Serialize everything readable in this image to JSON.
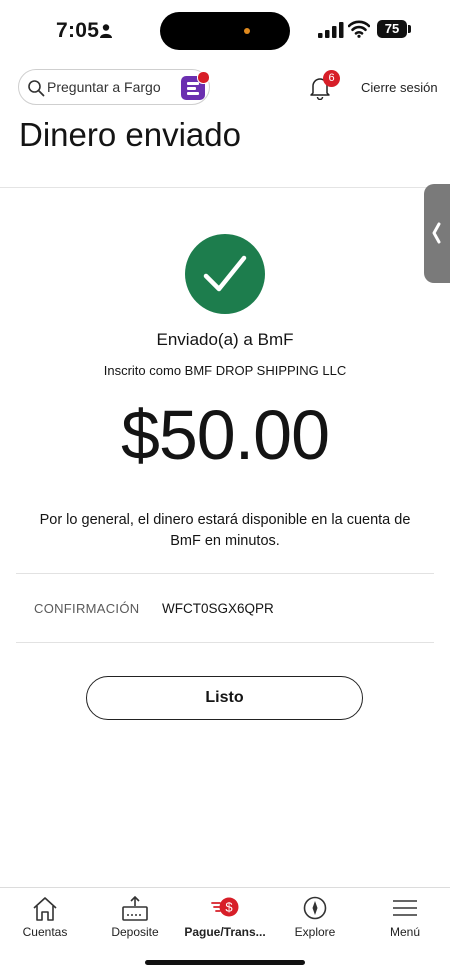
{
  "status_bar": {
    "time": "7:05",
    "battery": "75"
  },
  "header": {
    "search_label": "Preguntar a Fargo",
    "notification_count": "6",
    "sign_out": "Cierre sesión"
  },
  "page": {
    "title": "Dinero enviado"
  },
  "confirmation": {
    "sent_to": "Enviado(a) a BmF",
    "registered_as": "Inscrito como BMF DROP SHIPPING LLC",
    "amount": "$50.00",
    "availability_note": "Por lo general, el dinero estará disponible en la cuenta de BmF en minutos.",
    "confirmation_label": "CONFIRMACIÓN",
    "confirmation_number": "WFCT0SGX6QPR",
    "done_label": "Listo"
  },
  "tabs": [
    {
      "label": "Cuentas",
      "icon": "home-icon"
    },
    {
      "label": "Deposite",
      "icon": "deposit-icon"
    },
    {
      "label": "Pague/Trans...",
      "icon": "pay-transfer-icon",
      "active": true
    },
    {
      "label": "Explore",
      "icon": "compass-icon"
    },
    {
      "label": "Menú",
      "icon": "hamburger-icon"
    }
  ],
  "colors": {
    "success_green": "#1d7d4d",
    "brand_red": "#d71e28",
    "fargo_purple": "#6b2fb0"
  }
}
